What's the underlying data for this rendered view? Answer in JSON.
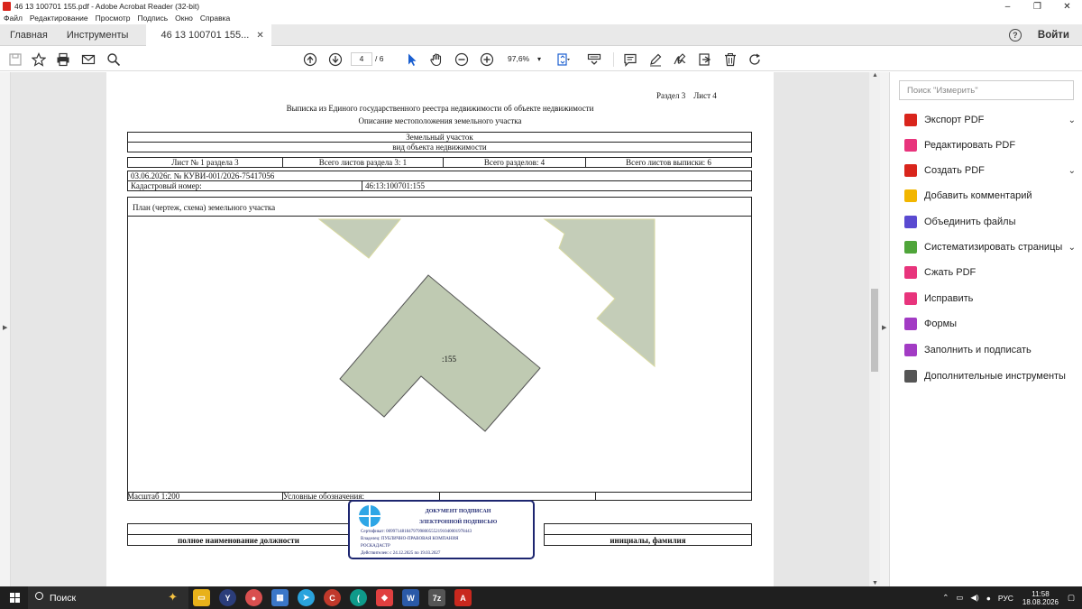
{
  "window": {
    "title": "46 13 100701 155.pdf - Adobe Acrobat Reader (32-bit)",
    "minimize": "–",
    "restore": "❐",
    "close": "✕"
  },
  "menu": [
    "Файл",
    "Редактирование",
    "Просмотр",
    "Подпись",
    "Окно",
    "Справка"
  ],
  "tabs": {
    "home": "Главная",
    "tools": "Инструменты",
    "document": "46 13 100701 155...",
    "close": "✕",
    "help": "?",
    "signin": "Войти"
  },
  "toolbar": {
    "page_current": "4",
    "page_total": "/ 6",
    "zoom": "97,6%"
  },
  "page": {
    "section": "Раздел 3    Лист 4",
    "title1": "Выписка из Единого государственного реестра недвижимости об объекте недвижимости",
    "title2": "Описание местоположения земельного участка",
    "object_type": "Земельный участок",
    "object_type_caption": "вид объекта недвижимости",
    "sheet": "Лист № 1 раздела 3",
    "sheets_section": "Всего листов раздела 3: 1",
    "sections_total": "Всего разделов: 4",
    "sheets_total": "Всего листов выписки: 6",
    "date_number": "03.06.2026г. № КУВИ-001/2026-75417056",
    "cadastral_label": "Кадастровый номер:",
    "cadastral_value": "46:13:100701:155",
    "plan_label": "План (чертеж, схема) земельного участка",
    "parcel_label": ":155",
    "scale": "Масштаб 1:200",
    "legend": "Условные обозначения:",
    "position_caption": "полное наименование должности",
    "initials_caption": "инициалы, фамилия"
  },
  "stamp": {
    "line1": "ДОКУМЕНТ ПОДПИСАН",
    "line2": "ЭЛЕКТРОННОЙ ПОДПИСЬЮ",
    "cert": "Сертификат: 00997148184797998005552191040001978443",
    "owner1": "Владелец: ПУБЛИЧНО-ПРАВОВАЯ КОМПАНИЯ",
    "owner2": "РОСКАДАСТР",
    "valid": "Действителен: с 24.12.2025 по 19.03.2027"
  },
  "right_panel": {
    "search_placeholder": "Поиск \"Измерить\"",
    "items": [
      {
        "label": "Экспорт PDF",
        "color": "#d9251c",
        "chev": "⌄"
      },
      {
        "label": "Редактировать PDF",
        "color": "#e8347c",
        "chev": ""
      },
      {
        "label": "Создать PDF",
        "color": "#d9251c",
        "chev": "⌄"
      },
      {
        "label": "Добавить комментарий",
        "color": "#f2b600",
        "chev": ""
      },
      {
        "label": "Объединить файлы",
        "color": "#5a4ad1",
        "chev": ""
      },
      {
        "label": "Систематизировать страницы",
        "color": "#4fa53a",
        "chev": "⌄"
      },
      {
        "label": "Сжать PDF",
        "color": "#e8347c",
        "chev": ""
      },
      {
        "label": "Исправить",
        "color": "#e8347c",
        "chev": ""
      },
      {
        "label": "Формы",
        "color": "#a23bc4",
        "chev": ""
      },
      {
        "label": "Заполнить и подписать",
        "color": "#a23bc4",
        "chev": ""
      },
      {
        "label": "Дополнительные инструменты",
        "color": "#555555",
        "chev": ""
      }
    ]
  },
  "taskbar": {
    "search": "Поиск",
    "lang": "РУС",
    "time": "11:58",
    "date": "18.08.2026"
  },
  "colors": {
    "parcel_fill": "#bfcab2",
    "neighbor_fill": "#c4cdb8",
    "stamp_border": "#1d2670"
  }
}
